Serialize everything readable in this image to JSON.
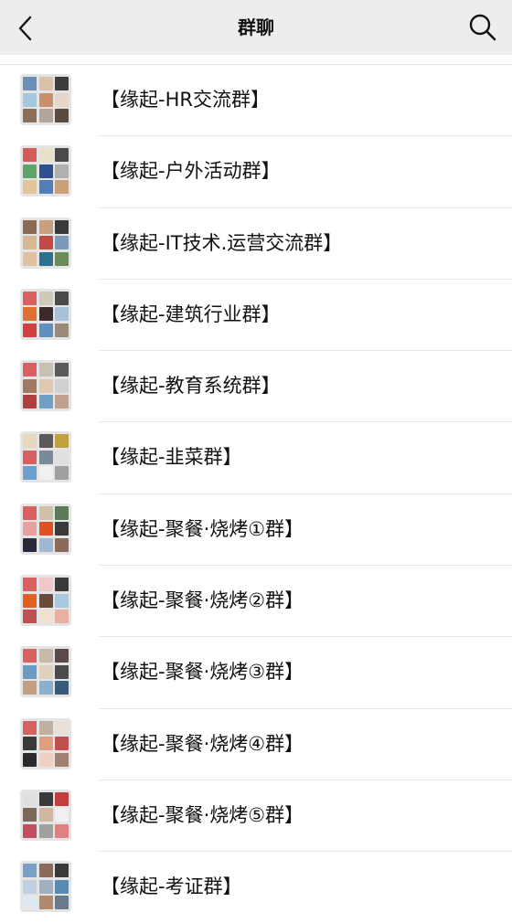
{
  "header": {
    "title": "群聊"
  },
  "groups": [
    {
      "name": "【缘起-HR交流群】",
      "colors": [
        "#6b8fb5",
        "#d9c2a8",
        "#3d3d3d",
        "#a5c8e0",
        "#c98f6b",
        "#e8d6c8",
        "#8a6f5a",
        "#b3a59a",
        "#5a4a40"
      ]
    },
    {
      "name": "【缘起-户外活动群】",
      "colors": [
        "#d65a5a",
        "#e8e0c8",
        "#4a4a4a",
        "#5fa36b",
        "#2f4f8f",
        "#b0b0b0",
        "#e3c59c",
        "#4f7fb8",
        "#c9a07a"
      ]
    },
    {
      "name": "【缘起-IT技术.运营交流群】",
      "colors": [
        "#8a6a52",
        "#c8a080",
        "#3a3a3a",
        "#d8b890",
        "#c44848",
        "#7a9ab8",
        "#e0c0a0",
        "#2f6f8f",
        "#6a8a5a"
      ]
    },
    {
      "name": "【缘起-建筑行业群】",
      "colors": [
        "#d86060",
        "#d0c8b8",
        "#4a4a4a",
        "#e07030",
        "#3a2a2a",
        "#a8c0d8",
        "#d04040",
        "#6090c0",
        "#9a8a7a"
      ]
    },
    {
      "name": "【缘起-教育系统群】",
      "colors": [
        "#d86060",
        "#c8c0b0",
        "#5a5a5a",
        "#a07a60",
        "#e0c8b0",
        "#d0d0d0",
        "#b04040",
        "#70a0c8",
        "#c0a090"
      ]
    },
    {
      "name": "【缘起-韭菜群】",
      "colors": [
        "#e8d8c0",
        "#5a5a5a",
        "#c0a040",
        "#d86060",
        "#7a8a9a",
        "#e0e0e0",
        "#6aa0d0",
        "#f0f0f0",
        "#a0a0a0"
      ]
    },
    {
      "name": "【缘起-聚餐·烧烤①群】",
      "colors": [
        "#d86060",
        "#d0c0a8",
        "#5a7a5a",
        "#e8a0a0",
        "#e05020",
        "#3a3a3a",
        "#2a2a3a",
        "#a0b8d0",
        "#8a6a5a"
      ]
    },
    {
      "name": "【缘起-聚餐·烧烤②群】",
      "colors": [
        "#d86060",
        "#f0c8c8",
        "#3a3a3a",
        "#e06020",
        "#6a4a3a",
        "#a8c8e0",
        "#c05050",
        "#f0e0d0",
        "#e8b0a0"
      ]
    },
    {
      "name": "【缘起-聚餐·烧烤③群】",
      "colors": [
        "#d86060",
        "#c8b8a8",
        "#5a4a4a",
        "#6a9ac0",
        "#e0d0c0",
        "#4a4a4a",
        "#c0a080",
        "#8ab0d0",
        "#3a5a7a"
      ]
    },
    {
      "name": "【缘起-聚餐·烧烤④群】",
      "colors": [
        "#d86060",
        "#c0b0a0",
        "#e8e0d8",
        "#3a3a3a",
        "#e0a080",
        "#c05050",
        "#2a2a2a",
        "#f0d0c0",
        "#a08070"
      ]
    },
    {
      "name": "【缘起-聚餐·烧烤⑤群】",
      "colors": [
        "#e0e0e0",
        "#3a3a3a",
        "#c04040",
        "#7a6a5a",
        "#d0b8a0",
        "#f0f0f0",
        "#c05060",
        "#a0a0a0",
        "#e08080"
      ]
    },
    {
      "name": "【缘起-考证群】",
      "colors": [
        "#7aa0c8",
        "#8a6a5a",
        "#3a3a3a",
        "#c0d0e0",
        "#a0b0c0",
        "#5a8ab0",
        "#e0e8f0",
        "#b08870",
        "#6a7a8a"
      ]
    }
  ]
}
